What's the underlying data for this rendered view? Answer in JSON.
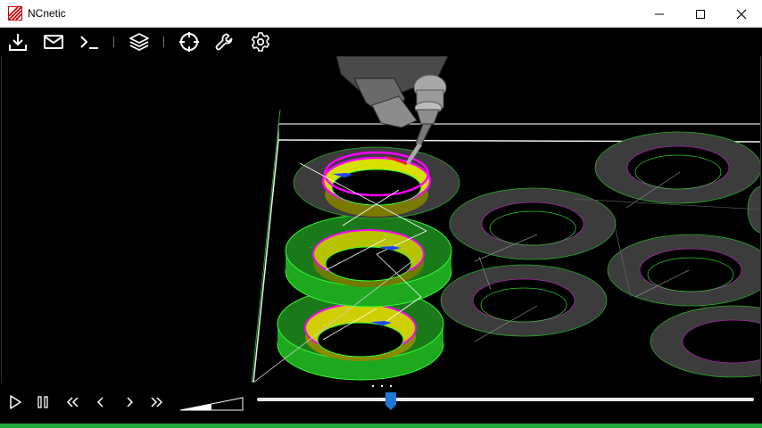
{
  "window": {
    "title": "NCnetic"
  },
  "toolbar": {
    "icons": [
      "download-icon",
      "mail-icon",
      "terminal-icon",
      "layers-icon",
      "crosshair-icon",
      "wrench-icon",
      "gear-icon"
    ]
  },
  "playback": {
    "controls": [
      "play-icon",
      "pause-icon",
      "rewind-icon",
      "step-back-icon",
      "step-forward-icon",
      "fast-forward-icon"
    ],
    "progress": 0.27
  },
  "colors": {
    "accent": "#1e78d7",
    "status": "#1fa83a",
    "toolpath": "#ff00ff",
    "part_green": "#22cc22",
    "part_yellow": "#c8d800"
  }
}
